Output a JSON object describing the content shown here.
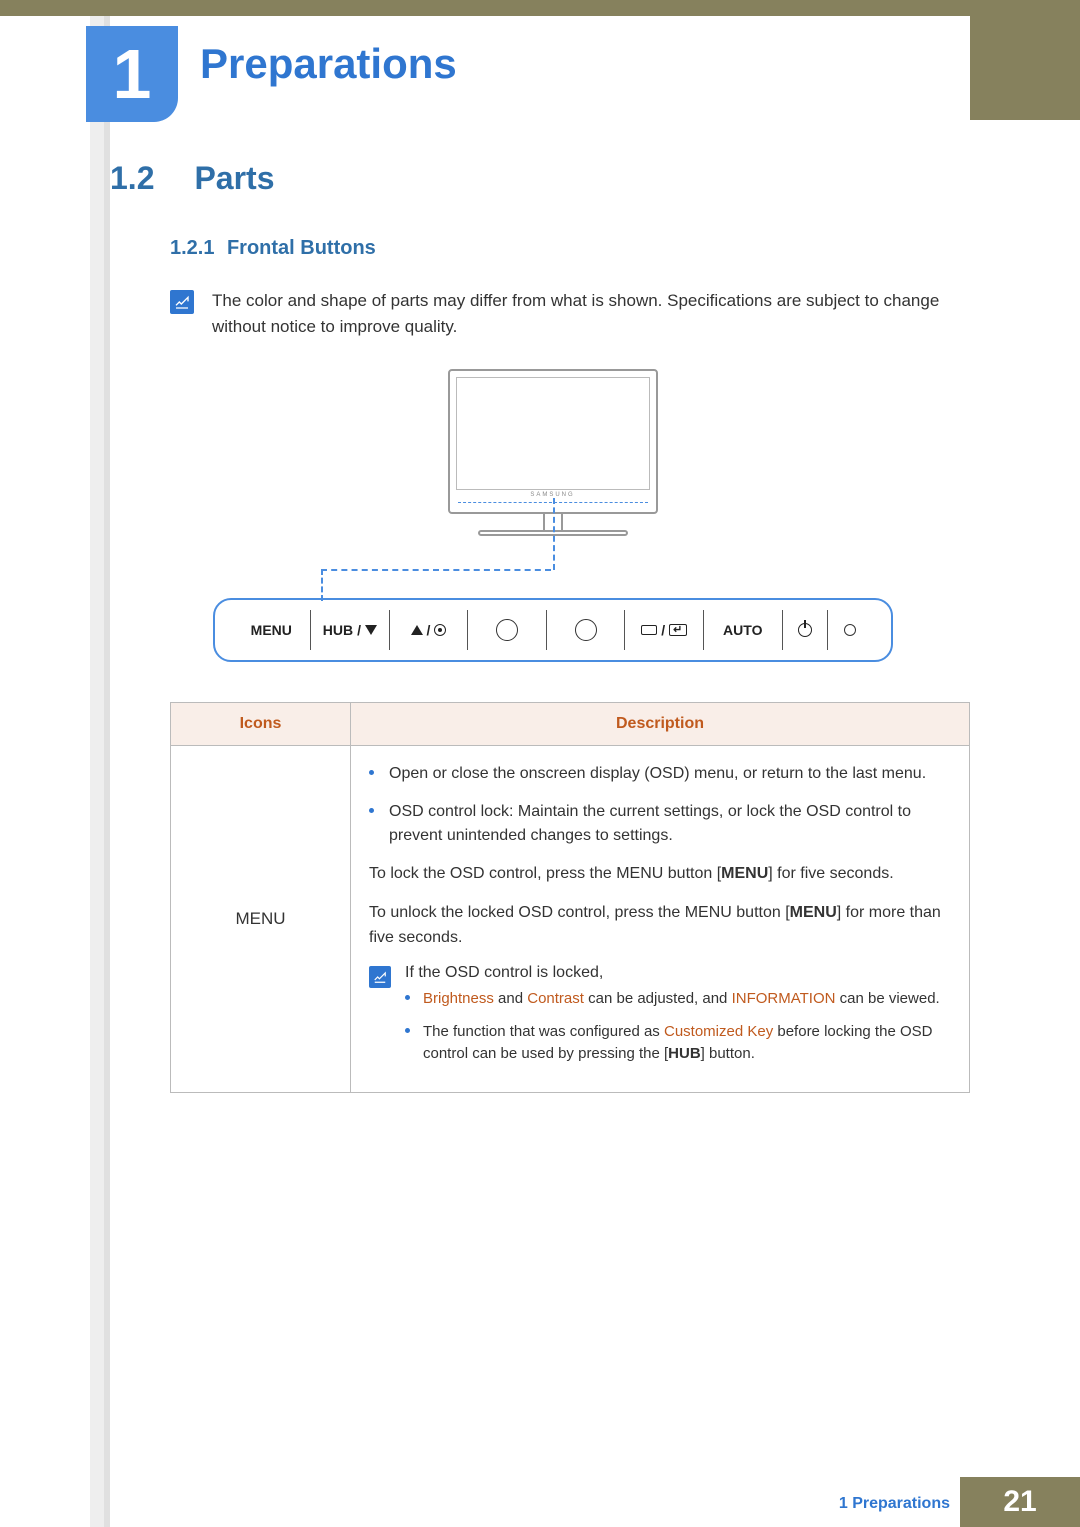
{
  "chapter": {
    "number": "1",
    "title": "Preparations"
  },
  "section": {
    "number": "1.2",
    "title": "Parts"
  },
  "subsection": {
    "number": "1.2.1",
    "title": "Frontal Buttons"
  },
  "note": {
    "text": "The color and shape of parts may differ from what is shown. Specifications are subject to change without notice to improve quality."
  },
  "monitor": {
    "brand": "SAMSUNG"
  },
  "button_panel": {
    "items": [
      {
        "label": "MENU"
      },
      {
        "label_prefix": "HUB",
        "slash": "/",
        "icon": "triangle-down"
      },
      {
        "icon": "triangle-up",
        "slash": "/",
        "icon2": "dot-circle"
      },
      {
        "icon": "circle-outline"
      },
      {
        "icon": "circle-outline"
      },
      {
        "icon": "rect-small",
        "slash": "/",
        "icon2": "rect-return"
      },
      {
        "label": "AUTO"
      },
      {
        "icon": "power"
      },
      {
        "icon": "led"
      }
    ]
  },
  "table": {
    "header": {
      "icons": "Icons",
      "description": "Description"
    },
    "row": {
      "icon_label": "MENU",
      "bullets": [
        "Open or close the onscreen display (OSD) menu, or return to the last menu.",
        "OSD control lock: Maintain the current settings, or lock the OSD control to prevent unintended changes to settings."
      ],
      "para1_pre": "To lock the OSD control, press the MENU button [",
      "para1_btn": "MENU",
      "para1_post": "] for five seconds.",
      "para2_pre": "To unlock the locked OSD control, press the MENU button [",
      "para2_btn": "MENU",
      "para2_post": "] for more than five seconds.",
      "subnote_intro": "If the OSD control is locked,",
      "sub_bullets": {
        "b1_hl1": "Brightness",
        "b1_mid": " and ",
        "b1_hl2": "Contrast",
        "b1_mid2": " can be adjusted, and ",
        "b1_hl3": "INFORMATION",
        "b1_end": " can be viewed.",
        "b2_pre": "The function that was configured as ",
        "b2_hl": "Customized Key",
        "b2_mid": " before locking the OSD control can be used by pressing the [",
        "b2_btn": "HUB",
        "b2_post": "] button."
      }
    }
  },
  "footer": {
    "crumb": "1 Preparations",
    "page": "21"
  }
}
